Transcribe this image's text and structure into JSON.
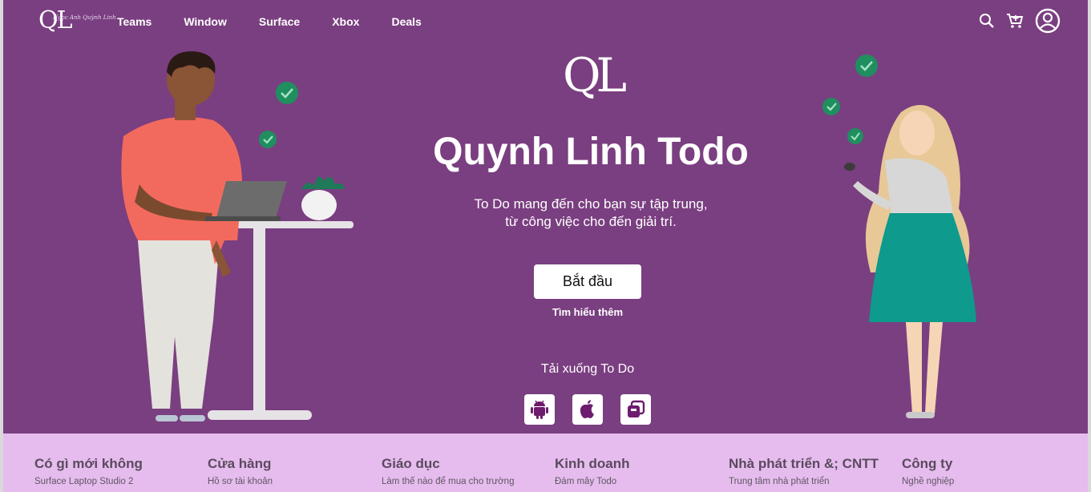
{
  "nav": {
    "logo_text": "QL",
    "logo_signature": "Ngọc Anh Quỳnh Linh",
    "links": [
      "Teams",
      "Window",
      "Surface",
      "Xbox",
      "Deals"
    ],
    "icons": [
      "search-icon",
      "cart-icon",
      "account-icon"
    ]
  },
  "hero": {
    "logo_text": "QL",
    "title": "Quynh Linh Todo",
    "subtitle_line1": "To Do mang đến cho bạn sự tập trung,",
    "subtitle_line2": "từ công việc cho đến giải trí.",
    "start_button": "Bắt đầu",
    "learn_more": "Tìm hiểu thêm",
    "download_title": "Tải xuống To Do",
    "download_icons": [
      "android-icon",
      "apple-icon",
      "windows-icon"
    ]
  },
  "colors": {
    "hero_background": "#7a3f80",
    "footer_background": "#e6bcee",
    "check_green": "#1f8f5f"
  },
  "footer": {
    "columns": [
      {
        "heading": "Có gì mới không",
        "first_link": "Surface Laptop Studio 2"
      },
      {
        "heading": "Cửa hàng",
        "first_link": "Hồ sơ tài khoản"
      },
      {
        "heading": "Giáo dục",
        "first_link": "Làm thế nào để mua cho trường"
      },
      {
        "heading": "Kinh doanh",
        "first_link": "Đám mây Todo"
      },
      {
        "heading": "Nhà phát triển &; CNTT",
        "first_link": "Trung tâm nhà phát triển"
      },
      {
        "heading": "Công ty",
        "first_link": "Nghề nghiệp"
      }
    ]
  }
}
